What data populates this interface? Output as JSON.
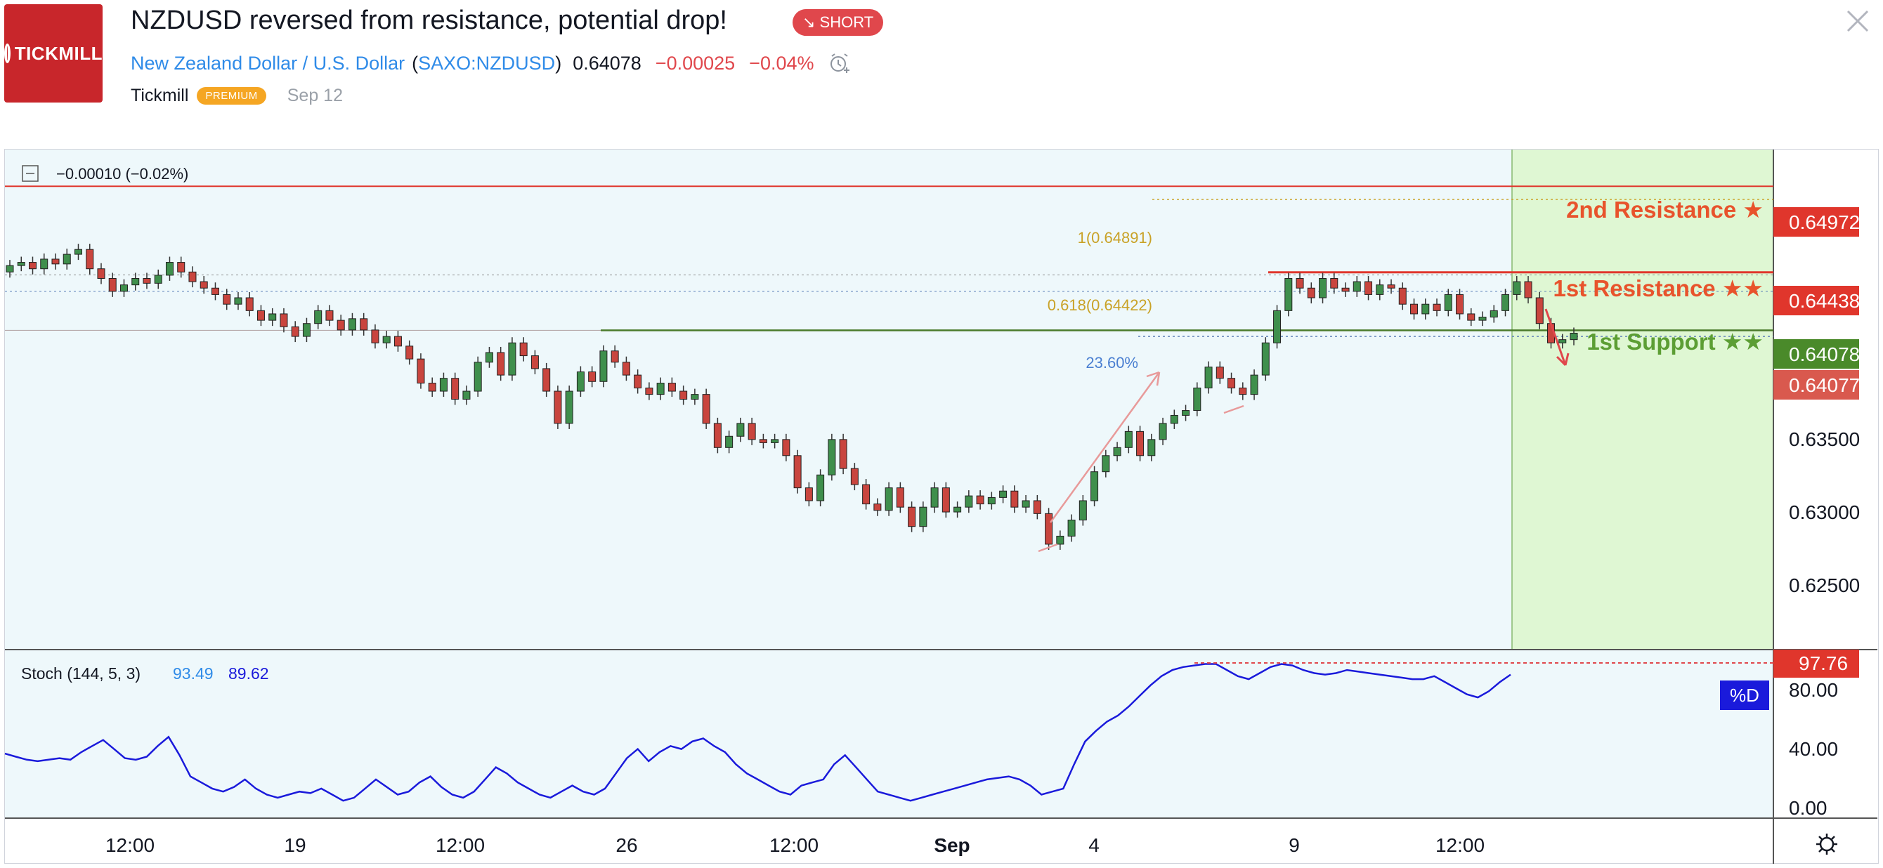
{
  "header": {
    "logo_text": "TICKMILL",
    "title": "NZDUSD reversed from resistance, potential drop!",
    "badge": "↘ SHORT",
    "symbol_name": "New Zealand Dollar / U.S. Dollar",
    "symbol_open": "(",
    "symbol_code": "SAXO:NZDUSD",
    "symbol_close": ")",
    "price": "0.64078",
    "change": "−0.00025",
    "change_pct": "−0.04%",
    "author": "Tickmill",
    "author_badge": "PREMIUM",
    "date": "Sep 12"
  },
  "icons": {
    "alarm": "alarm-clock-plus-icon",
    "close": "close-icon",
    "collapse": "minus-square-icon",
    "settings": "gear-icon"
  },
  "colors": {
    "accent_red": "#e0474c",
    "resistance": "#e8532c",
    "support": "#5c9e34",
    "fib": "#c9a227",
    "stoch_line": "#1a1adb",
    "chart_bg": "#eef8fb",
    "projection_bg": "#dff7d3"
  },
  "chart_data": {
    "type": "candlestick",
    "legend_change": "−0.00010 (−0.02%)",
    "y_ticks": [
      "0.63500",
      "0.63000",
      "0.62500"
    ],
    "x_ticks": [
      "12:00",
      "19",
      "12:00",
      "26",
      "12:00",
      "Sep",
      "4",
      "9",
      "12:00"
    ],
    "levels": [
      {
        "label": "2nd Resistance ★",
        "price": 0.64972,
        "price_label": "0.64972"
      },
      {
        "label": "1st Resistance ★★",
        "price": 0.64438,
        "price_label": "0.64438"
      },
      {
        "label": "1st Support ★★",
        "price": 0.64078,
        "price_label": "0.64078"
      }
    ],
    "current_price_label": "0.64077",
    "fib_levels": [
      {
        "label": "1(0.64891)",
        "price": 0.64891
      },
      {
        "label": "0.618(0.64422)",
        "price": 0.64422
      },
      {
        "label": "23.60%",
        "price": 0.6404
      }
    ],
    "ylim": [
      0.621,
      0.652
    ],
    "close_series": [
      0.6448,
      0.645,
      0.6446,
      0.6452,
      0.6449,
      0.6455,
      0.6458,
      0.6446,
      0.644,
      0.6432,
      0.6436,
      0.644,
      0.6437,
      0.6442,
      0.645,
      0.6444,
      0.6438,
      0.6434,
      0.643,
      0.6424,
      0.6428,
      0.642,
      0.6414,
      0.6418,
      0.641,
      0.6404,
      0.6412,
      0.642,
      0.6414,
      0.6408,
      0.6415,
      0.6408,
      0.64,
      0.6404,
      0.6398,
      0.639,
      0.6375,
      0.637,
      0.6378,
      0.6365,
      0.637,
      0.6388,
      0.6394,
      0.638,
      0.64,
      0.6392,
      0.6384,
      0.637,
      0.635,
      0.637,
      0.6382,
      0.6376,
      0.6395,
      0.6388,
      0.638,
      0.6372,
      0.6368,
      0.6375,
      0.637,
      0.6365,
      0.6368,
      0.635,
      0.6335,
      0.6342,
      0.635,
      0.634,
      0.6338,
      0.634,
      0.633,
      0.631,
      0.6302,
      0.6318,
      0.634,
      0.6322,
      0.6312,
      0.63,
      0.6296,
      0.631,
      0.6298,
      0.6286,
      0.6298,
      0.631,
      0.6295,
      0.6298,
      0.6305,
      0.63,
      0.6304,
      0.6308,
      0.6298,
      0.6302,
      0.6294,
      0.6275,
      0.628,
      0.629,
      0.6302,
      0.632,
      0.633,
      0.6335,
      0.6345,
      0.633,
      0.634,
      0.635,
      0.6355,
      0.6358,
      0.6372,
      0.6385,
      0.6378,
      0.6372,
      0.6368,
      0.638,
      0.64,
      0.642,
      0.644,
      0.6434,
      0.6428,
      0.644,
      0.6434,
      0.6432,
      0.6438,
      0.643,
      0.6436,
      0.6434,
      0.6424,
      0.6418,
      0.6424,
      0.642,
      0.643,
      0.6418,
      0.6414,
      0.6416,
      0.642,
      0.643,
      0.6438,
      0.6428,
      0.6412,
      0.64,
      0.6402,
      0.6406
    ],
    "stoch": {
      "label": "Stoch (144, 5, 3)",
      "k": "93.49",
      "d": "89.62",
      "ticks": [
        "80.00",
        "40.00",
        "0.00"
      ],
      "level_label": "97.76",
      "line_label": "%D",
      "ylim": [
        -5,
        105
      ],
      "values": [
        37,
        35,
        33,
        32,
        33,
        34,
        33,
        38,
        42,
        46,
        40,
        34,
        33,
        35,
        42,
        48,
        36,
        22,
        18,
        14,
        12,
        15,
        20,
        14,
        10,
        8,
        10,
        12,
        11,
        14,
        10,
        6,
        8,
        14,
        20,
        15,
        10,
        12,
        18,
        22,
        15,
        10,
        8,
        12,
        20,
        28,
        24,
        18,
        14,
        10,
        8,
        12,
        16,
        12,
        10,
        14,
        24,
        34,
        40,
        32,
        38,
        42,
        40,
        45,
        47,
        42,
        38,
        30,
        24,
        20,
        16,
        12,
        10,
        16,
        18,
        20,
        30,
        36,
        28,
        20,
        12,
        10,
        8,
        6,
        8,
        10,
        12,
        14,
        16,
        18,
        20,
        21,
        22,
        20,
        16,
        10,
        12,
        14,
        30,
        45,
        52,
        58,
        62,
        68,
        75,
        82,
        88,
        92,
        94,
        95,
        96,
        96,
        92,
        88,
        86,
        90,
        94,
        96,
        95,
        92,
        90,
        89,
        90,
        92,
        91,
        90,
        89,
        88,
        87,
        86,
        86,
        88,
        84,
        80,
        76,
        74,
        78,
        84,
        89
      ]
    }
  }
}
